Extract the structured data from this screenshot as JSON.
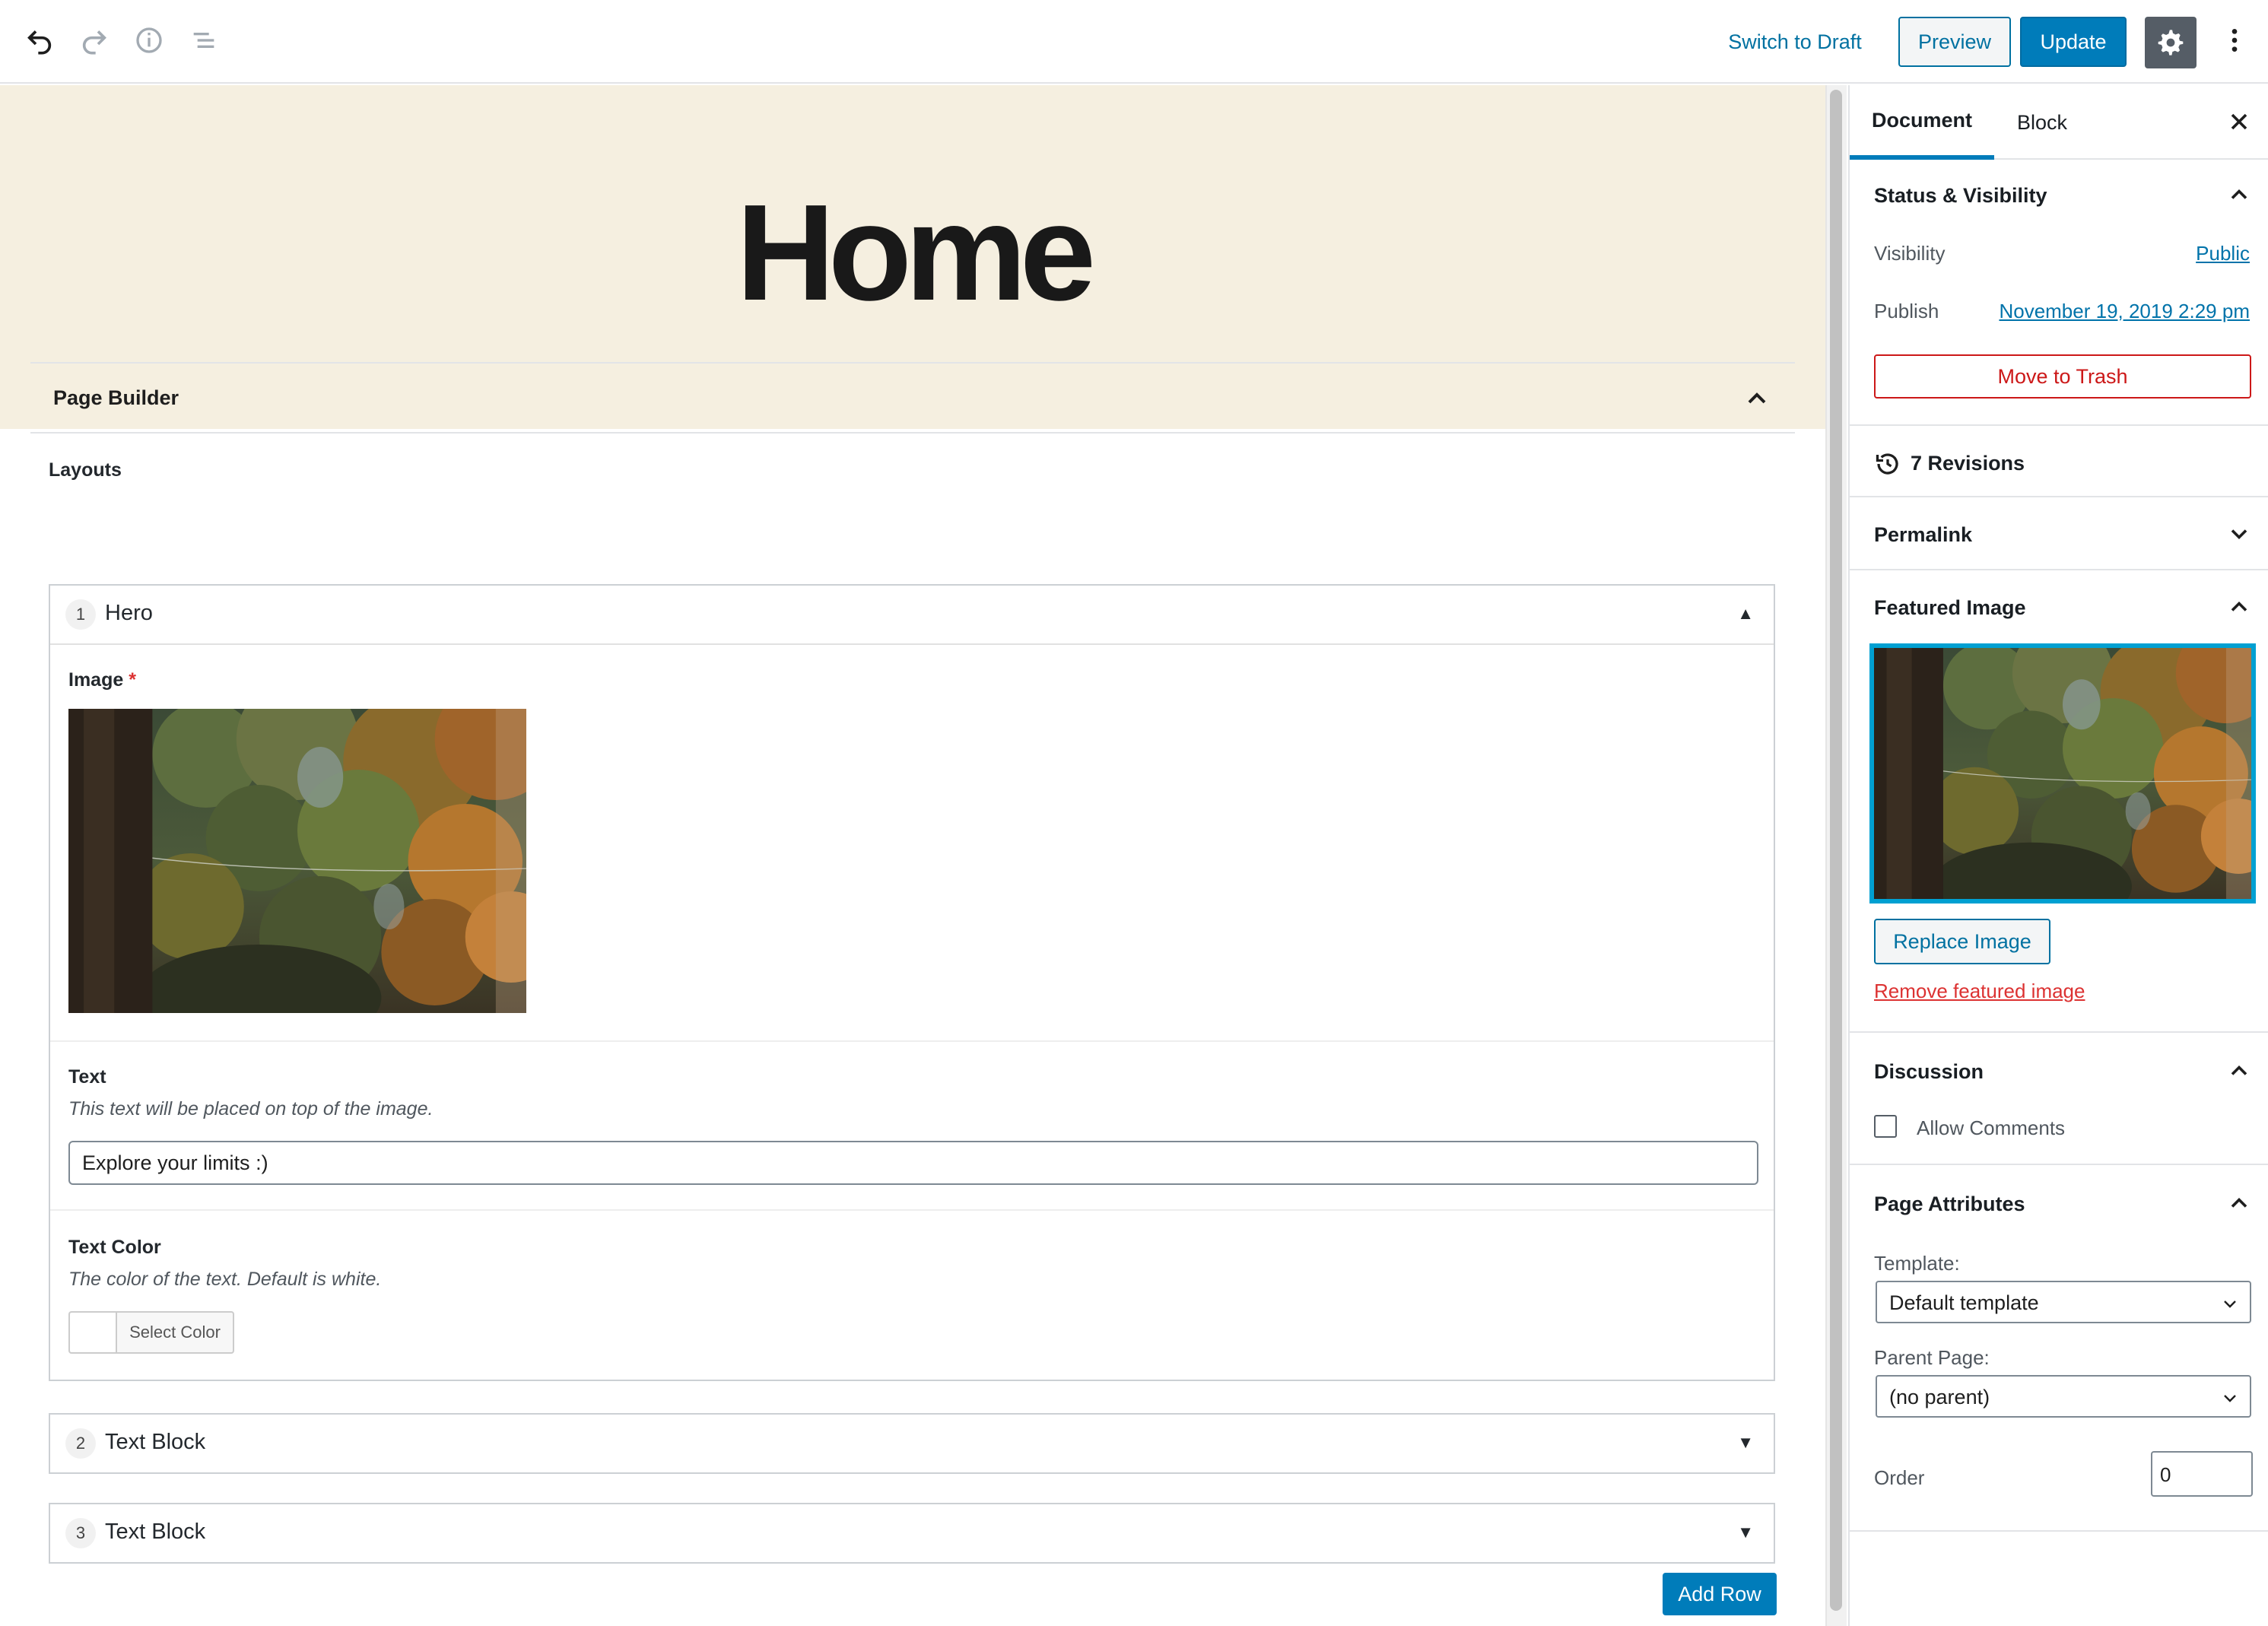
{
  "toolbar": {
    "undo_icon": "undo-icon",
    "redo_icon": "redo-icon",
    "info_icon": "info-icon",
    "outline_icon": "list-outline-icon",
    "switch_to_draft": "Switch to Draft",
    "preview": "Preview",
    "update": "Update",
    "settings_icon": "gear-icon",
    "more_icon": "more-vertical-icon"
  },
  "editor": {
    "page_title": "Home",
    "banner_color": "#f5efe0"
  },
  "page_builder": {
    "title": "Page Builder",
    "layouts_label": "Layouts",
    "layouts": [
      {
        "number": "1",
        "name": "Hero",
        "expanded": true,
        "toggle": "▲",
        "fields": {
          "image_label": "Image",
          "required_mark": "*",
          "text_label": "Text",
          "text_desc": "This text will be placed on top of the image.",
          "text_value": "Explore your limits :)",
          "color_label": "Text Color",
          "color_desc": "The color of the text. Default is white.",
          "color_button": "Select Color"
        }
      },
      {
        "number": "2",
        "name": "Text Block",
        "expanded": false,
        "toggle": "▼"
      },
      {
        "number": "3",
        "name": "Text Block",
        "expanded": false,
        "toggle": "▼"
      }
    ],
    "add_row": "Add Row"
  },
  "sidebar": {
    "tabs": [
      "Document",
      "Block"
    ],
    "active_tab": "Document",
    "status": {
      "title": "Status & Visibility",
      "visibility_label": "Visibility",
      "visibility_value": "Public",
      "publish_label": "Publish",
      "publish_value": "November 19, 2019 2:29 pm",
      "trash": "Move to Trash"
    },
    "revisions": "7 Revisions",
    "permalink": "Permalink",
    "featured_image": {
      "title": "Featured Image",
      "replace": "Replace Image",
      "remove": "Remove featured image"
    },
    "discussion": {
      "title": "Discussion",
      "allow_comments": "Allow Comments",
      "checked": false
    },
    "page_attributes": {
      "title": "Page Attributes",
      "template_label": "Template:",
      "template_value": "Default template",
      "parent_label": "Parent Page:",
      "parent_value": "(no parent)",
      "order_label": "Order",
      "order_value": "0"
    }
  },
  "colors": {
    "primary": "#007cba",
    "link": "#0073aa",
    "danger": "#cc1818",
    "selected_border": "#00a0d2"
  }
}
